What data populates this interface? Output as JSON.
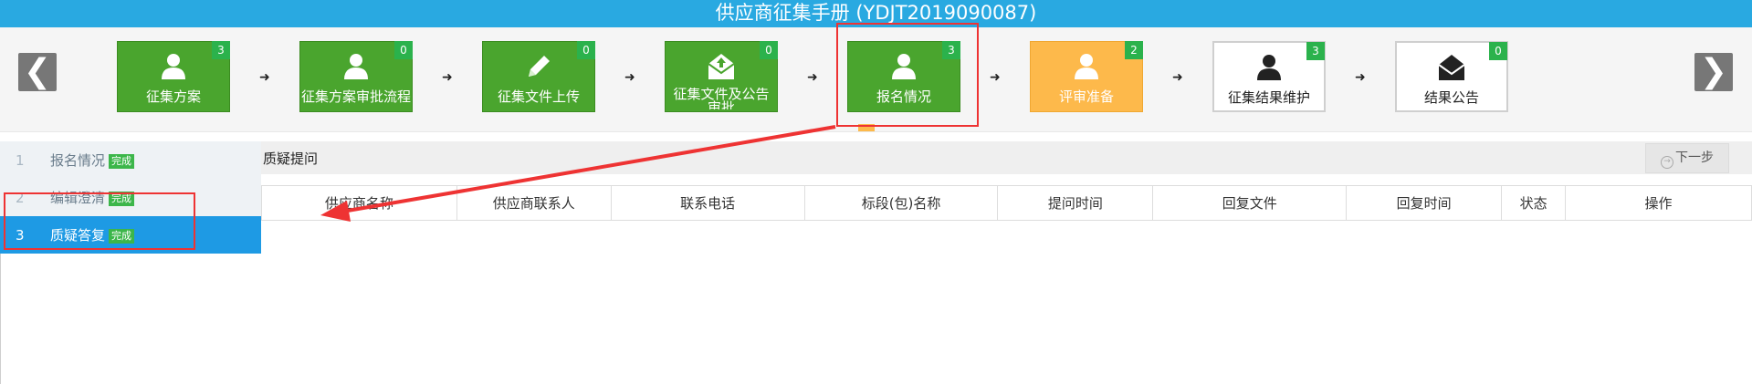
{
  "window": {
    "title": "供应商征集手册 (YDJT2019090087)"
  },
  "nav": {
    "prev_symbol": "❮",
    "next_symbol": "❯"
  },
  "steps": [
    {
      "label": "征集方案",
      "count": "3",
      "icon": "user-icon",
      "status": "completed"
    },
    {
      "label": "征集方案审批流程",
      "count": "0",
      "icon": "user-icon",
      "status": "completed"
    },
    {
      "label": "征集文件上传",
      "count": "0",
      "icon": "pencil-icon",
      "status": "completed"
    },
    {
      "label": "征集文件及公告审批",
      "count": "0",
      "icon": "envelope-upload-icon",
      "status": "completed"
    },
    {
      "label": "报名情况",
      "count": "3",
      "icon": "user-icon",
      "status": "current"
    },
    {
      "label": "评审准备",
      "count": "2",
      "icon": "user-icon",
      "status": "in-progress"
    },
    {
      "label": "征集结果维护",
      "count": "3",
      "icon": "user-icon",
      "status": "pending"
    },
    {
      "label": "结果公告",
      "count": "0",
      "icon": "envelope-icon",
      "status": "pending"
    }
  ],
  "sidebar": {
    "items": [
      {
        "num": "1",
        "label": "报名情况",
        "badge": "完成"
      },
      {
        "num": "2",
        "label": "编辑澄清",
        "badge": "完成"
      },
      {
        "num": "3",
        "label": "质疑答复",
        "badge": "完成"
      }
    ]
  },
  "panel": {
    "title": "质疑提问",
    "next_button": "下一步"
  },
  "table": {
    "columns": [
      "供应商名称",
      "供应商联系人",
      "联系电话",
      "标段(包)名称",
      "提问时间",
      "回复文件",
      "回复时间",
      "状态",
      "操作"
    ],
    "rows": []
  },
  "colors": {
    "title_bar": "#29a9e1",
    "step_done": "#4aa52e",
    "step_active_orange": "#fdb94b",
    "selected": "#1e9ae4",
    "annotation_red": "#ee3333"
  }
}
